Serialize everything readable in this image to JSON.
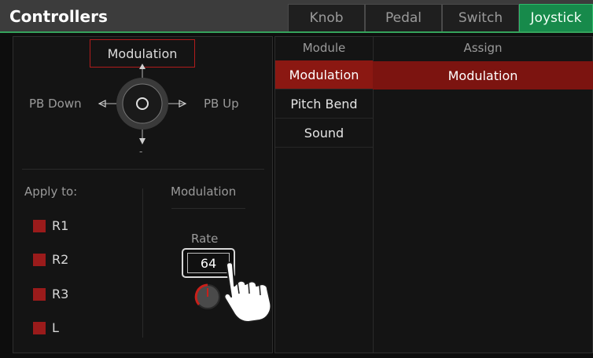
{
  "header": {
    "title": "Controllers"
  },
  "tabs": [
    {
      "label": "Knob"
    },
    {
      "label": "Pedal"
    },
    {
      "label": "Switch"
    },
    {
      "label": "Joystick",
      "active": true
    }
  ],
  "joystick": {
    "up_label": "Modulation",
    "left_label": "PB Down",
    "right_label": "PB Up",
    "down_label": "-"
  },
  "apply": {
    "title": "Apply to:",
    "parts": [
      {
        "label": "R1"
      },
      {
        "label": "R2"
      },
      {
        "label": "R3"
      },
      {
        "label": "L"
      }
    ]
  },
  "modulation": {
    "title": "Modulation",
    "rate_label": "Rate",
    "rate_value": "64"
  },
  "table": {
    "module_header": "Module",
    "assign_header": "Assign",
    "modules": [
      {
        "label": "Modulation",
        "selected": true
      },
      {
        "label": "Pitch Bend"
      },
      {
        "label": "Sound"
      }
    ],
    "assign_value": "Modulation"
  },
  "colors": {
    "accent_green": "#178a4b",
    "accent_red": "#8b1812"
  },
  "icons": [
    "joystick-icon",
    "arrow-up-icon",
    "arrow-down-icon",
    "arrow-left-icon",
    "arrow-right-icon",
    "knob-icon",
    "hand-pointer-icon"
  ]
}
